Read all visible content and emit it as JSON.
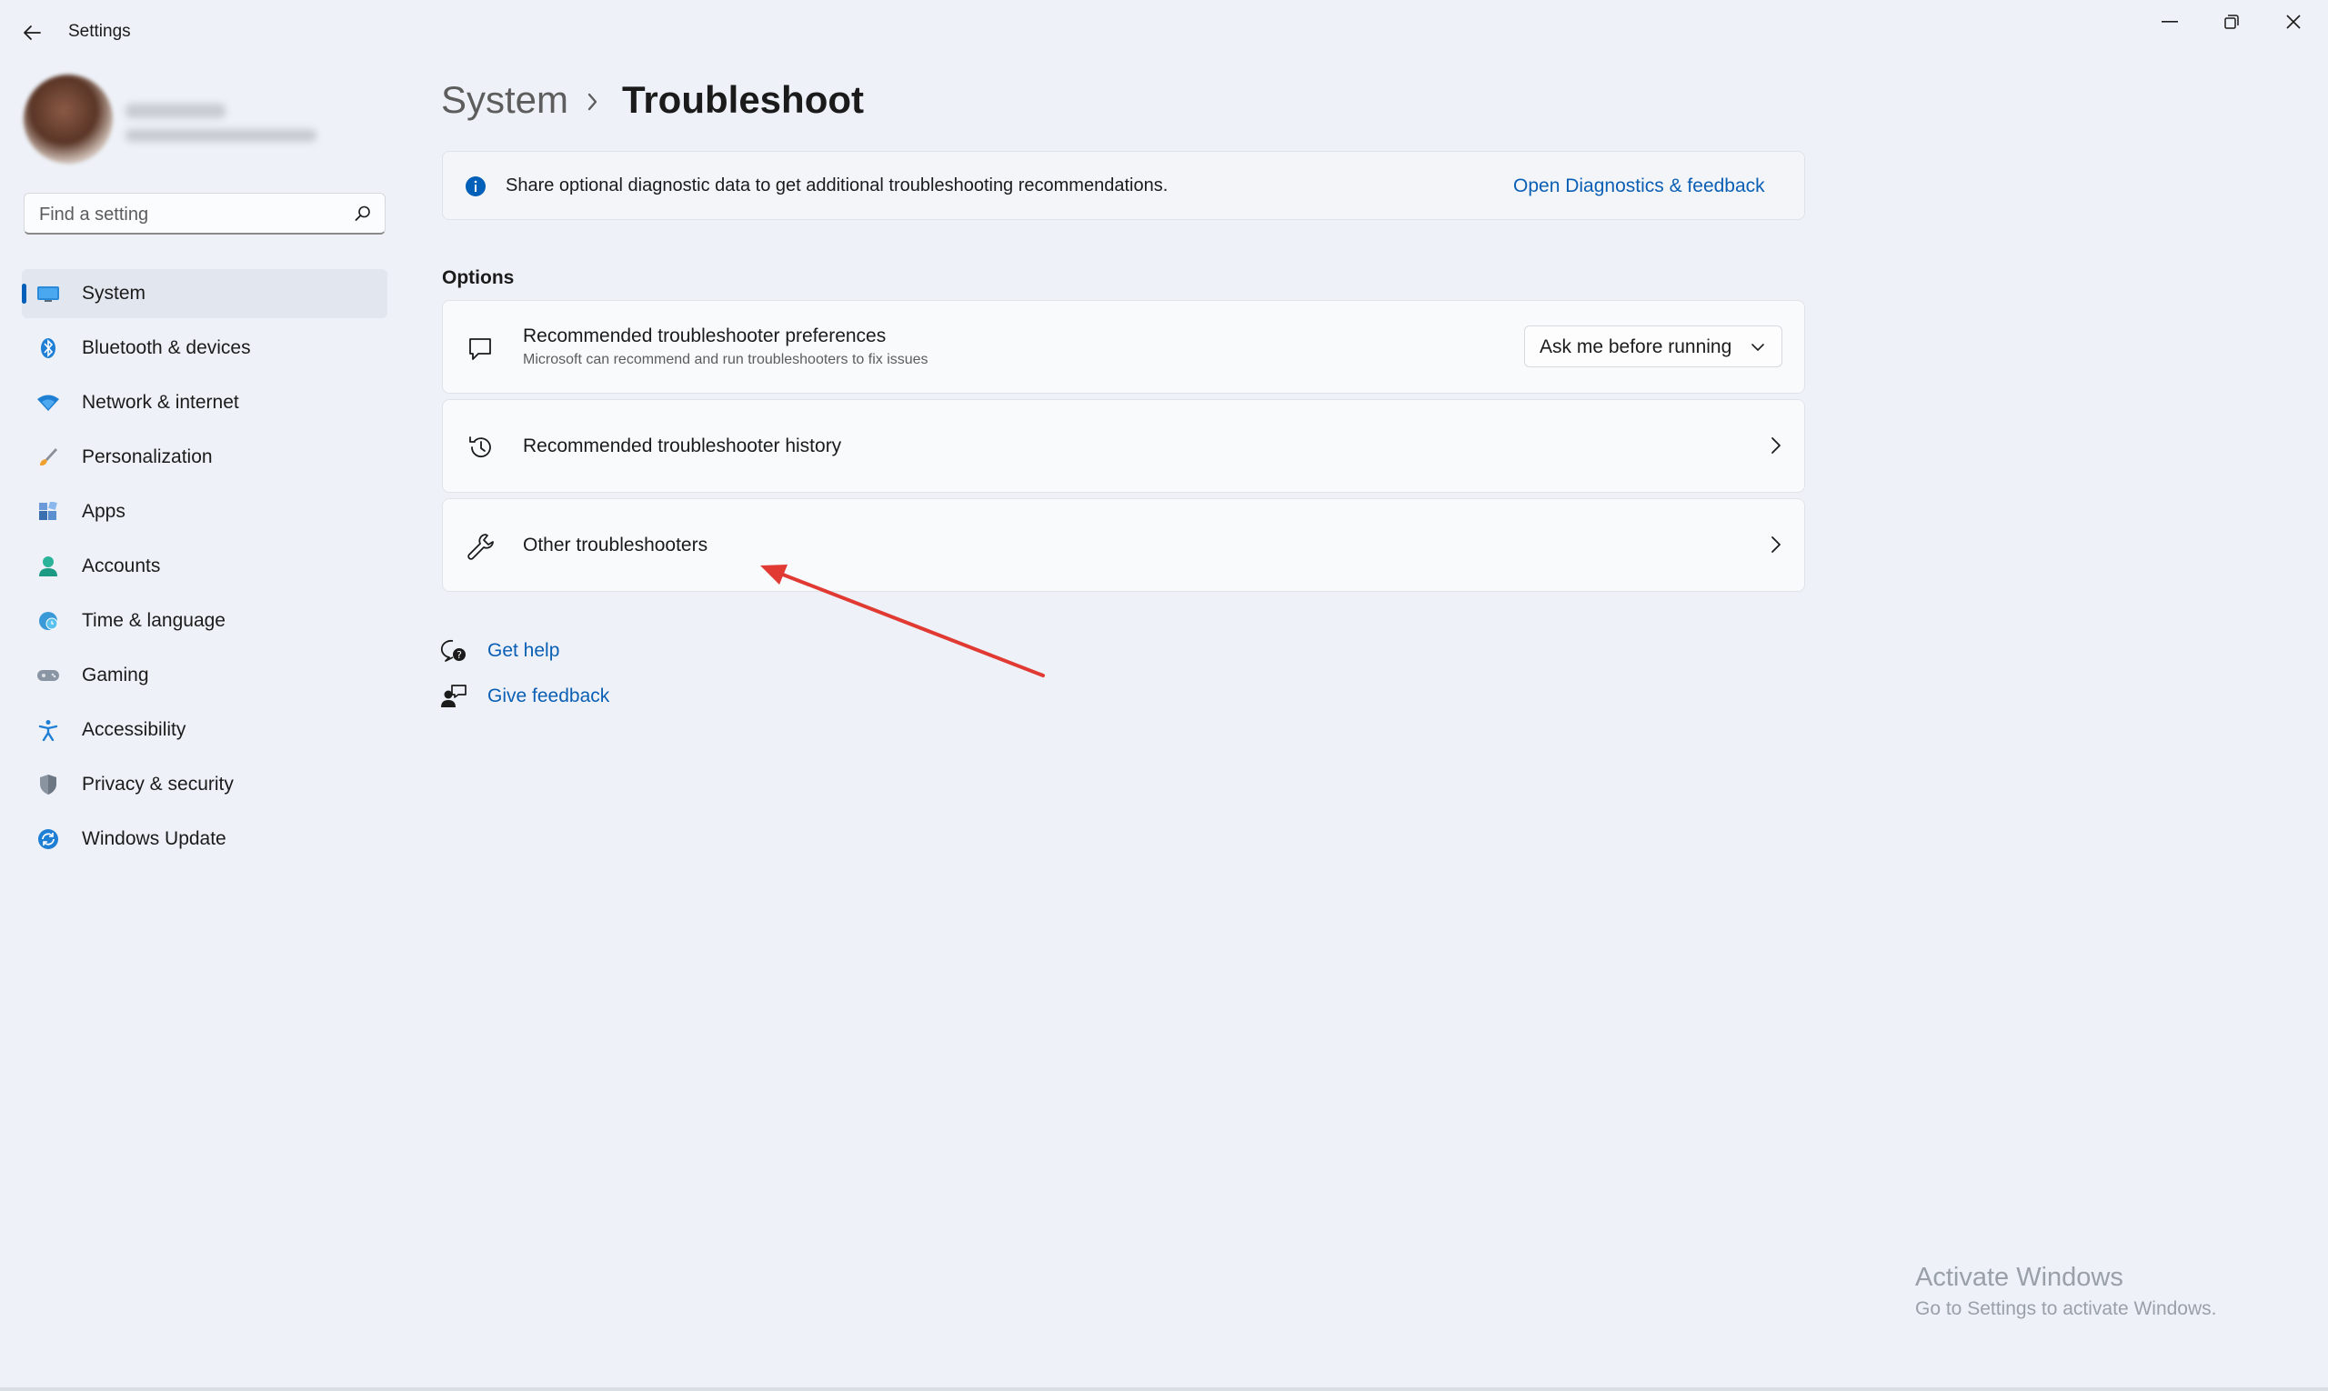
{
  "window": {
    "title": "Settings",
    "controls": [
      "minimize-icon",
      "restore-icon",
      "close-icon"
    ]
  },
  "search": {
    "placeholder": "Find a setting"
  },
  "sidebar": {
    "items": [
      {
        "label": "System",
        "icon": "system-icon",
        "active": true
      },
      {
        "label": "Bluetooth & devices",
        "icon": "bluetooth-icon"
      },
      {
        "label": "Network & internet",
        "icon": "network-icon"
      },
      {
        "label": "Personalization",
        "icon": "brush-icon"
      },
      {
        "label": "Apps",
        "icon": "apps-icon"
      },
      {
        "label": "Accounts",
        "icon": "accounts-icon"
      },
      {
        "label": "Time & language",
        "icon": "globe-clock-icon"
      },
      {
        "label": "Gaming",
        "icon": "gamepad-icon"
      },
      {
        "label": "Accessibility",
        "icon": "accessibility-icon"
      },
      {
        "label": "Privacy & security",
        "icon": "shield-icon"
      },
      {
        "label": "Windows Update",
        "icon": "update-icon"
      }
    ]
  },
  "breadcrumb": {
    "parent": "System",
    "separator": "›",
    "current": "Troubleshoot"
  },
  "info_bar": {
    "text": "Share optional diagnostic data to get additional troubleshooting recommendations.",
    "link": "Open Diagnostics & feedback"
  },
  "options": {
    "heading": "Options",
    "rows": [
      {
        "title": "Recommended troubleshooter preferences",
        "subtitle": "Microsoft can recommend and run troubleshooters to fix issues",
        "dropdown_value": "Ask me before running",
        "icon": "chat-bubble-icon"
      },
      {
        "title": "Recommended troubleshooter history",
        "icon": "history-icon"
      },
      {
        "title": "Other troubleshooters",
        "icon": "wrench-icon"
      }
    ]
  },
  "help_links": [
    {
      "label": "Get help",
      "icon": "help-icon"
    },
    {
      "label": "Give feedback",
      "icon": "feedback-icon"
    }
  ],
  "watermark": {
    "title": "Activate Windows",
    "subtitle": "Go to Settings to activate Windows."
  },
  "colors": {
    "accent": "#005fb8",
    "link": "#0a5fb4",
    "annotation_arrow": "#e03a33"
  }
}
